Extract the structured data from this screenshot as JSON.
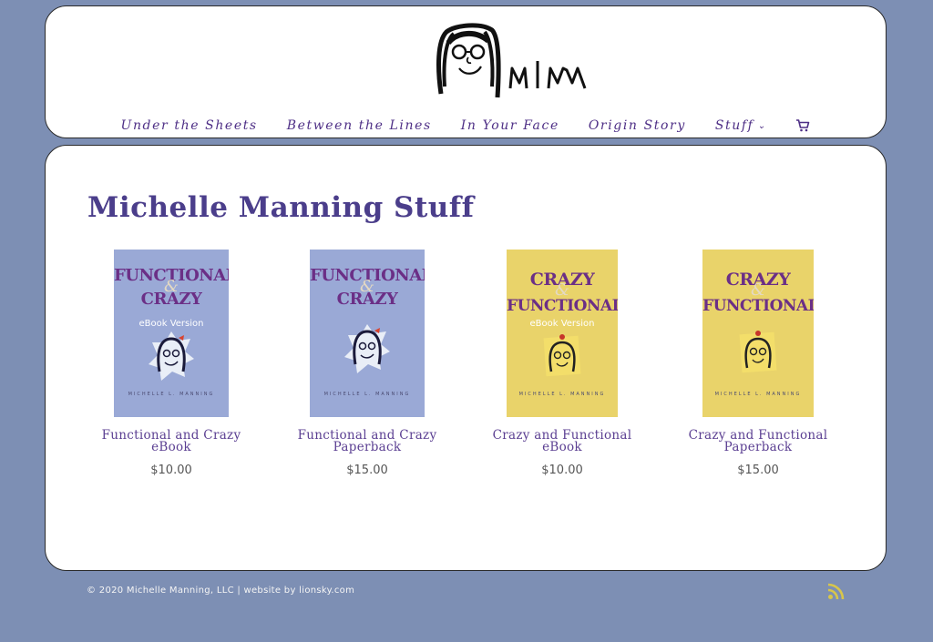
{
  "brand": {
    "logo_text": "MlM"
  },
  "nav": {
    "items": [
      {
        "label": "Under the Sheets"
      },
      {
        "label": "Between the Lines"
      },
      {
        "label": "In Your Face"
      },
      {
        "label": "Origin Story"
      },
      {
        "label": "Stuff"
      }
    ],
    "cart_icon": "shopping-cart-icon"
  },
  "main": {
    "title": "Michelle Manning Stuff",
    "products": [
      {
        "cover_line1": "FUNCTIONAL",
        "cover_amp": "&",
        "cover_line2": "CRAZY",
        "cover_badge": "eBook Version",
        "cover_author": "MICHELLE L. MANNING",
        "name_line1": "Functional and Crazy",
        "name_line2": "eBook",
        "price": "$10.00"
      },
      {
        "cover_line1": "FUNCTIONAL",
        "cover_amp": "&",
        "cover_line2": "CRAZY",
        "cover_badge": "",
        "cover_author": "MICHELLE L. MANNING",
        "name_line1": "Functional and Crazy",
        "name_line2": "Paperback",
        "price": "$15.00"
      },
      {
        "cover_line1": "CRAZY",
        "cover_amp": "&",
        "cover_line2": "FUNCTIONAL",
        "cover_badge": "eBook Version",
        "cover_author": "MICHELLE L. MANNING",
        "name_line1": "Crazy and Functional",
        "name_line2": "eBook",
        "price": "$10.00"
      },
      {
        "cover_line1": "CRAZY",
        "cover_amp": "&",
        "cover_line2": "FUNCTIONAL",
        "cover_badge": "",
        "cover_author": "MICHELLE L. MANNING",
        "name_line1": "Crazy and Functional",
        "name_line2": "Paperback",
        "price": "$15.00"
      }
    ]
  },
  "footer": {
    "text": "© 2020 Michelle Manning, LLC | website by lionsky.com",
    "rss_icon": "rss-icon"
  },
  "colors": {
    "background": "#7d8fb4",
    "nav_text": "#4e2f86",
    "title": "#4b3e8b",
    "rss": "#d8c64a"
  }
}
